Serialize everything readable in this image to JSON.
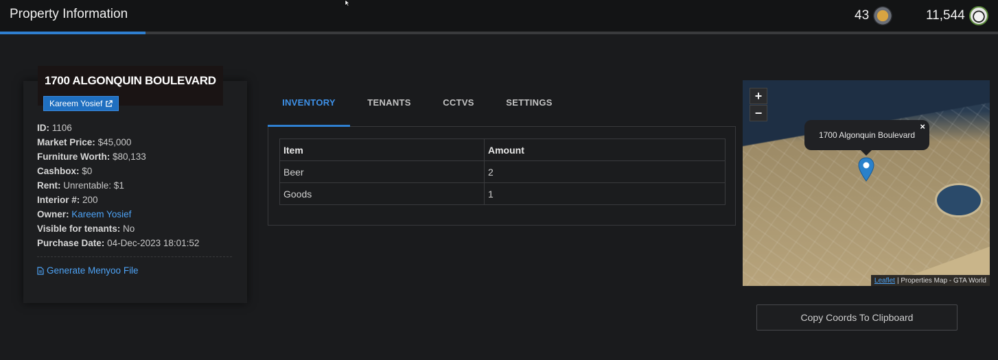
{
  "header": {
    "title": "Property Information",
    "progress_fraction": 0.146,
    "stats": [
      {
        "value": "43",
        "icon": "medal-icon"
      },
      {
        "value": "11,544",
        "icon": "panda-avatar-icon"
      }
    ]
  },
  "property": {
    "address": "1700 ALGONQUIN BOULEVARD",
    "owner_button": "Kareem Yosief",
    "fields": [
      {
        "label": "ID:",
        "value": "1106"
      },
      {
        "label": "Market Price:",
        "value": "$45,000"
      },
      {
        "label": "Furniture Worth:",
        "value": "$80,133"
      },
      {
        "label": "Cashbox:",
        "value": "$0"
      },
      {
        "label": "Rent:",
        "value": "Unrentable: $1"
      },
      {
        "label": "Interior #:",
        "value": "200"
      },
      {
        "label": "Owner:",
        "value": "Kareem Yosief"
      },
      {
        "label": "Visible for tenants:",
        "value": "No"
      },
      {
        "label": "Purchase Date:",
        "value": "04-Dec-2023 18:01:52"
      }
    ],
    "menyoo_link": "Generate Menyoo File"
  },
  "tabs": [
    {
      "label": "INVENTORY",
      "active": true
    },
    {
      "label": "TENANTS",
      "active": false
    },
    {
      "label": "CCTVS",
      "active": false
    },
    {
      "label": "SETTINGS",
      "active": false
    }
  ],
  "inventory": {
    "headers": [
      "Item",
      "Amount"
    ],
    "rows": [
      [
        "Beer",
        "2"
      ],
      [
        "Goods",
        "1"
      ]
    ]
  },
  "map": {
    "zoom_in": "+",
    "zoom_out": "−",
    "popup_text": "1700 Algonquin Boulevard",
    "popup_close": "×",
    "attribution_link": "Leaflet",
    "attribution_text": "| Properties Map - GTA World"
  },
  "copy_button": "Copy Coords To Clipboard",
  "colors": {
    "accent": "#2f7fd0",
    "link": "#4ea3f5",
    "background": "#1a1b1d"
  }
}
